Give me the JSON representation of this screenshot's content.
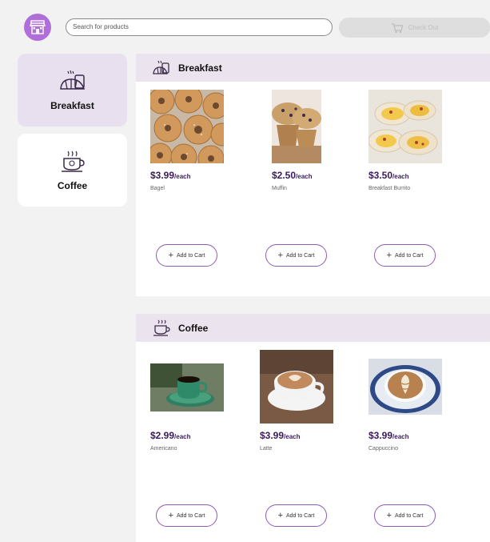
{
  "header": {
    "logo_icon": "store-icon",
    "search_placeholder": "Search for products",
    "checkout_label": "Check Out",
    "checkout_icon": "cart-icon"
  },
  "sidebar": {
    "items": [
      {
        "label": "Breakfast",
        "icon": "croissant-icon",
        "active": true
      },
      {
        "label": "Coffee",
        "icon": "coffee-cup-icon",
        "active": false
      }
    ]
  },
  "sections": [
    {
      "title": "Breakfast",
      "icon": "bread-icon",
      "products": [
        {
          "price": "$3.99",
          "unit": "/each",
          "name": "Bagel",
          "add_label": "Add to Cart"
        },
        {
          "price": "$2.50",
          "unit": "/each",
          "name": "Muffin",
          "add_label": "Add to Cart"
        },
        {
          "price": "$3.50",
          "unit": "/each",
          "name": "Breakfast Burrito",
          "add_label": "Add to Cart"
        }
      ]
    },
    {
      "title": "Coffee",
      "icon": "coffee-cup-icon",
      "products": [
        {
          "price": "$2.99",
          "unit": "/each",
          "name": "Americano",
          "add_label": "Add to Cart"
        },
        {
          "price": "$3.99",
          "unit": "/each",
          "name": "Latte",
          "add_label": "Add to Cart"
        },
        {
          "price": "$3.99",
          "unit": "/each",
          "name": "Cappuccino",
          "add_label": "Add to Cart"
        }
      ]
    }
  ],
  "colors": {
    "accent": "#b06fd8",
    "header_bg": "#ebe4ee",
    "active_card_bg": "#e8e0ef",
    "price_text": "#3b1c5a",
    "button_border": "#8e5cb5"
  }
}
